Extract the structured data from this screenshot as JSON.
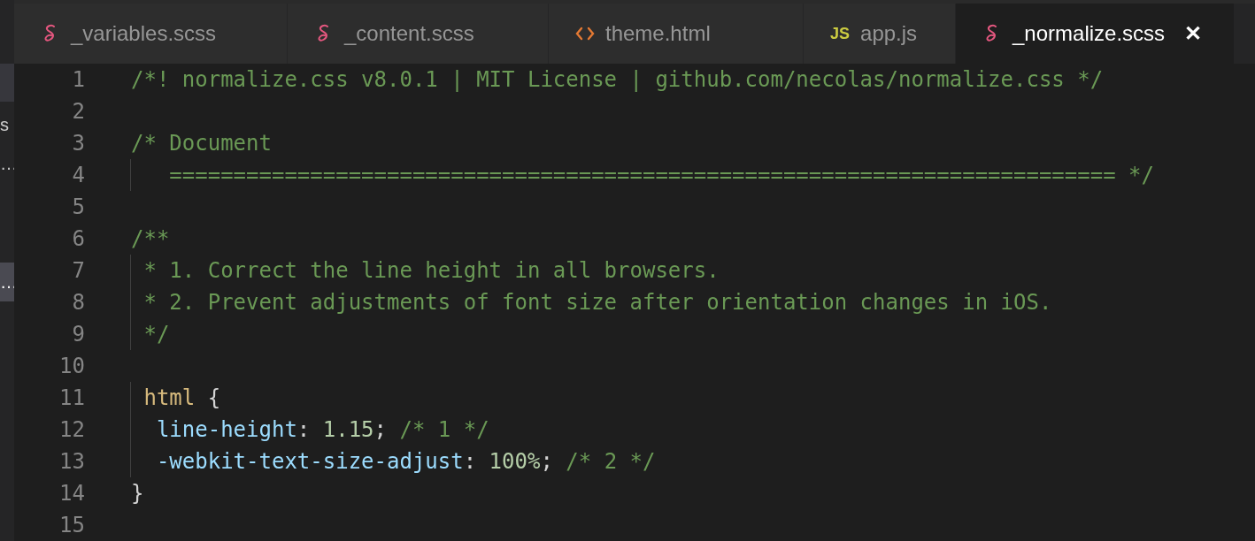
{
  "sidebar": {
    "items": [
      {
        "text": "s",
        "selected": false
      },
      {
        "text": "…",
        "selected": false
      },
      {
        "text": "…",
        "selected": true
      }
    ]
  },
  "tabs": [
    {
      "label": "_variables.scss",
      "kind": "sass",
      "selected": false
    },
    {
      "label": "_content.scss",
      "kind": "sass",
      "selected": false
    },
    {
      "label": "theme.html",
      "kind": "html",
      "selected": false
    },
    {
      "label": "app.js",
      "kind": "js",
      "icon_text": "JS",
      "selected": false
    },
    {
      "label": "_normalize.scss",
      "kind": "sass",
      "selected": true,
      "close": "✕"
    }
  ],
  "editor": {
    "lines": [
      {
        "number": "1",
        "tokens": [
          {
            "kind": "comment",
            "text": "/*! normalize.css v8.0.1 | MIT License | github.com/necolas/normalize.css */"
          }
        ]
      },
      {
        "number": "2"
      },
      {
        "number": "3",
        "tokens": [
          {
            "kind": "comment",
            "text": "/* Document"
          }
        ]
      },
      {
        "number": "4",
        "tokens": [
          {
            "kind": "comment",
            "text": "   ========================================================================== */"
          }
        ]
      },
      {
        "number": "5"
      },
      {
        "number": "6",
        "tokens": [
          {
            "kind": "comment",
            "text": "/**"
          }
        ]
      },
      {
        "number": "7",
        "tokens": [
          {
            "kind": "comment",
            "text": " * 1. Correct the line height in all browsers."
          }
        ]
      },
      {
        "number": "8",
        "tokens": [
          {
            "kind": "comment",
            "text": " * 2. Prevent adjustments of font size after orientation changes in iOS."
          }
        ]
      },
      {
        "number": "9",
        "tokens": [
          {
            "kind": "comment",
            "text": " */"
          }
        ]
      },
      {
        "number": "10"
      },
      {
        "number": "11",
        "tokens": [
          {
            "kind": "selector",
            "text": " html"
          },
          {
            "kind": "punct",
            "text": " {"
          }
        ]
      },
      {
        "number": "12",
        "tokens": [
          {
            "kind": "property",
            "text": "  line-height"
          },
          {
            "kind": "punct",
            "text": ":"
          },
          {
            "kind": "number",
            "text": " 1.15"
          },
          {
            "kind": "punct",
            "text": ";"
          },
          {
            "kind": "comment",
            "text": " /* 1 */"
          }
        ]
      },
      {
        "number": "13",
        "tokens": [
          {
            "kind": "property",
            "text": "  -webkit-text-size-adjust"
          },
          {
            "kind": "punct",
            "text": ":"
          },
          {
            "kind": "number",
            "text": " 100%"
          },
          {
            "kind": "punct",
            "text": ";"
          },
          {
            "kind": "comment",
            "text": " /* 2 */"
          }
        ]
      },
      {
        "number": "14",
        "tokens": [
          {
            "kind": "punct",
            "text": "}"
          }
        ]
      },
      {
        "number": "15"
      }
    ]
  }
}
